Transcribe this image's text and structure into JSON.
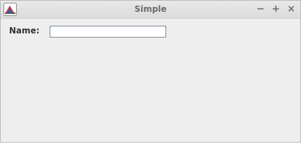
{
  "window": {
    "title": "Simple",
    "controls": {
      "minimize": "−",
      "maximize": "+",
      "close": "×"
    },
    "icon": "java-app-icon"
  },
  "form": {
    "name_label": "Name:",
    "name_value": "",
    "name_placeholder": ""
  },
  "colors": {
    "window_bg": "#eeeeee",
    "titlebar_bg": "#dcdcdc",
    "title_text": "#6b6b6b",
    "field_border": "#7a8a99"
  }
}
